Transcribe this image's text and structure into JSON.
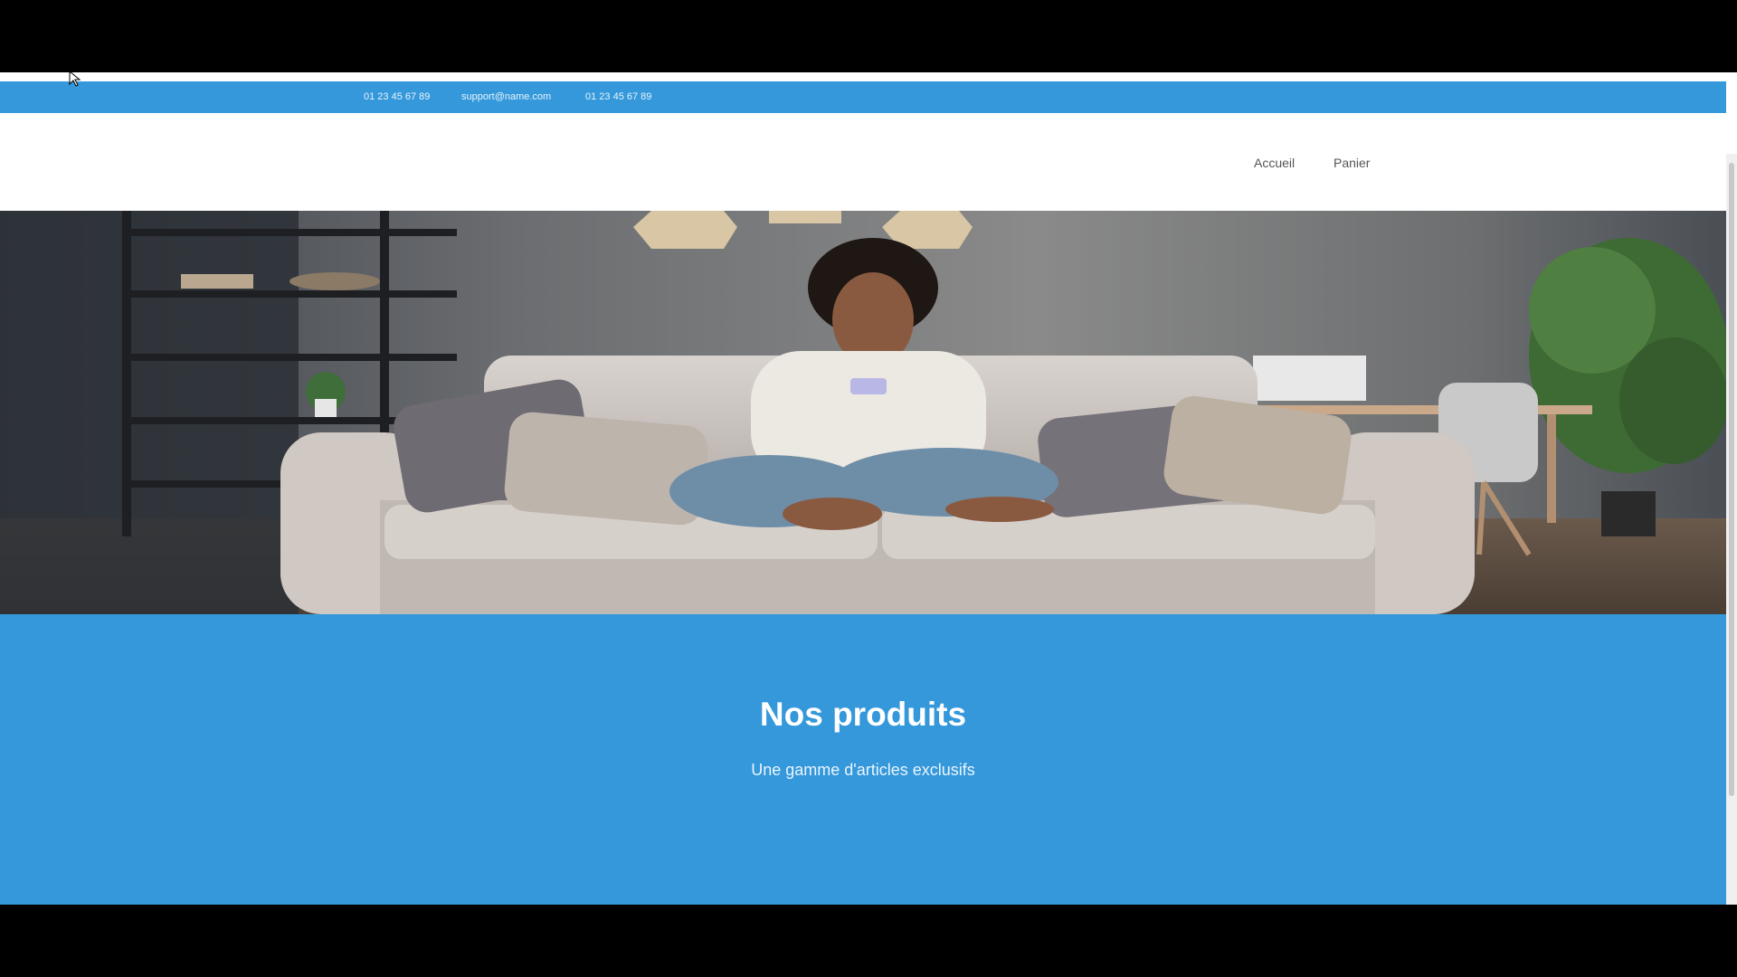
{
  "topbar": {
    "phone_1": "01 23 45 67 89",
    "email": "support@name.com",
    "phone_2": "01 23 45 67 89"
  },
  "nav": {
    "home": "Accueil",
    "cart": "Panier"
  },
  "products": {
    "title": "Nos produits",
    "subtitle": "Une gamme d'articles exclusifs"
  },
  "colors": {
    "accent": "#3498db",
    "header_bg": "#ffffff",
    "frame_bg": "#000000"
  },
  "icons": {
    "cursor": "mouse-cursor-icon"
  }
}
